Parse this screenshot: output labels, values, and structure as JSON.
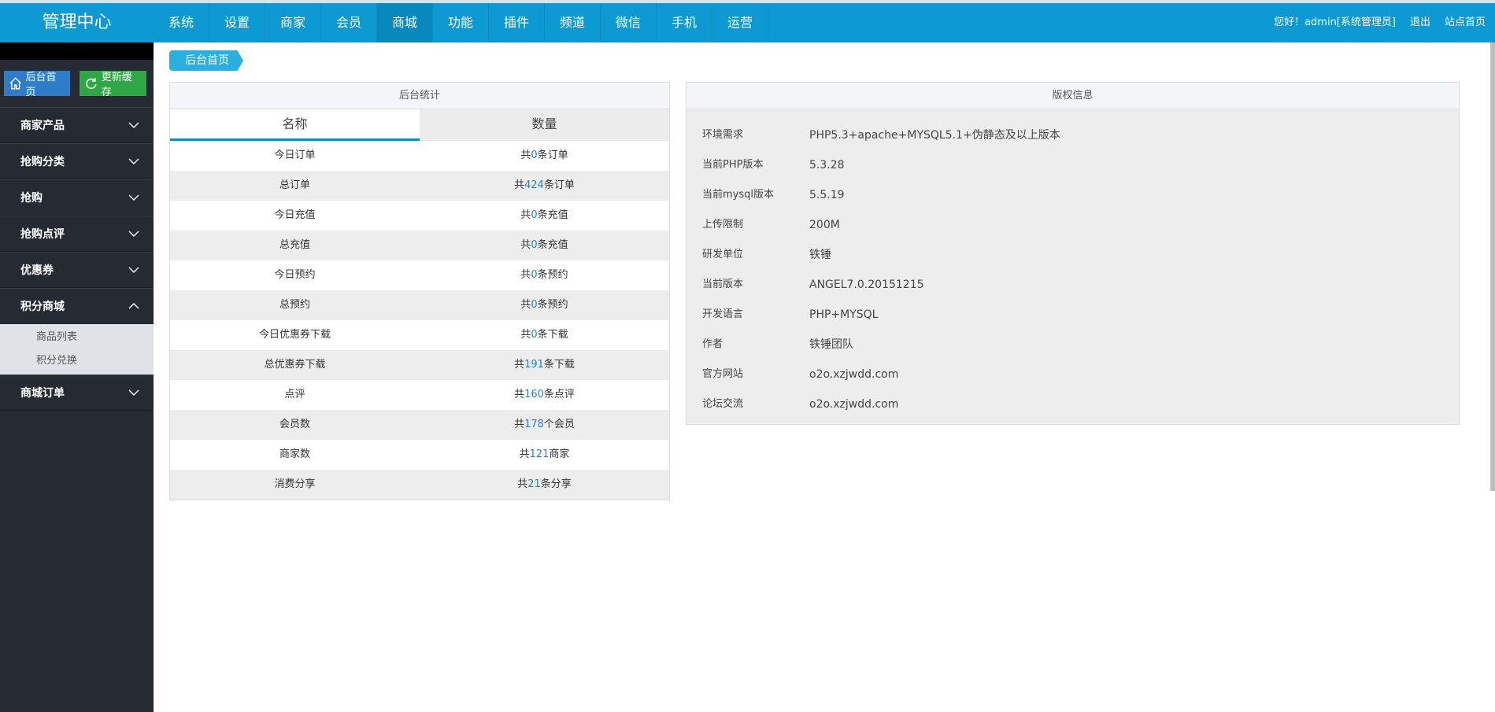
{
  "brand": "管理中心",
  "nav": [
    "系统",
    "设置",
    "商家",
    "会员",
    "商城",
    "功能",
    "插件",
    "频道",
    "微信",
    "手机",
    "运营"
  ],
  "nav_active_index": 4,
  "user": {
    "greeting": "您好！admin[系统管理员]",
    "logout": "退出",
    "site_home": "站点首页"
  },
  "quick": {
    "home": "后台首页",
    "cache": "更新缓存"
  },
  "sidebar": {
    "items": [
      {
        "label": "商家产品"
      },
      {
        "label": "抢购分类"
      },
      {
        "label": "抢购"
      },
      {
        "label": "抢购点评"
      },
      {
        "label": "优惠券"
      },
      {
        "label": "积分商城",
        "expanded": true,
        "children": [
          "商品列表",
          "积分兑换"
        ]
      },
      {
        "label": "商城订单"
      }
    ]
  },
  "breadcrumb": "后台首页",
  "stats": {
    "title": "后台统计",
    "col_name": "名称",
    "col_count": "数量",
    "rows": [
      {
        "name": "今日订单",
        "pre": "共",
        "num": "0",
        "suf": "条订单"
      },
      {
        "name": "总订单",
        "pre": "共",
        "num": "424",
        "suf": "条订单"
      },
      {
        "name": "今日充值",
        "pre": "共",
        "num": "0",
        "suf": "条充值"
      },
      {
        "name": "总充值",
        "pre": "共",
        "num": "0",
        "suf": "条充值"
      },
      {
        "name": "今日预约",
        "pre": "共",
        "num": "0",
        "suf": "条预约"
      },
      {
        "name": "总预约",
        "pre": "共",
        "num": "0",
        "suf": "条预约"
      },
      {
        "name": "今日优惠券下载",
        "pre": "共",
        "num": "0",
        "suf": "条下载"
      },
      {
        "name": "总优惠券下载",
        "pre": "共",
        "num": "191",
        "suf": "条下载"
      },
      {
        "name": "点评",
        "pre": "共",
        "num": "160",
        "suf": "条点评"
      },
      {
        "name": "会员数",
        "pre": "共",
        "num": "178",
        "suf": "个会员"
      },
      {
        "name": "商家数",
        "pre": "共",
        "num": "121",
        "suf": "商家"
      },
      {
        "name": "消费分享",
        "pre": "共",
        "num": "21",
        "suf": "条分享"
      }
    ]
  },
  "info": {
    "title": "版权信息",
    "rows": [
      {
        "k": "环境需求",
        "v": "PHP5.3+apache+MYSQL5.1+伪静态及以上版本"
      },
      {
        "k": "当前PHP版本",
        "v": "5.3.28"
      },
      {
        "k": "当前mysql版本",
        "v": "5.5.19"
      },
      {
        "k": "上传限制",
        "v": "200M"
      },
      {
        "k": "研发单位",
        "v": "铁锤"
      },
      {
        "k": "当前版本",
        "v": "ANGEL7.0.20151215"
      },
      {
        "k": "开发语言",
        "v": "PHP+MYSQL"
      },
      {
        "k": "作者",
        "v": "铁锤团队"
      },
      {
        "k": "官方网站",
        "v": "o2o.xzjwdd.com"
      },
      {
        "k": "论坛交流",
        "v": "o2o.xzjwdd.com"
      }
    ]
  },
  "colors": {
    "topbar": "#0d9ad3",
    "sidebar": "#262a33",
    "link_number": "#2f7ec1"
  }
}
